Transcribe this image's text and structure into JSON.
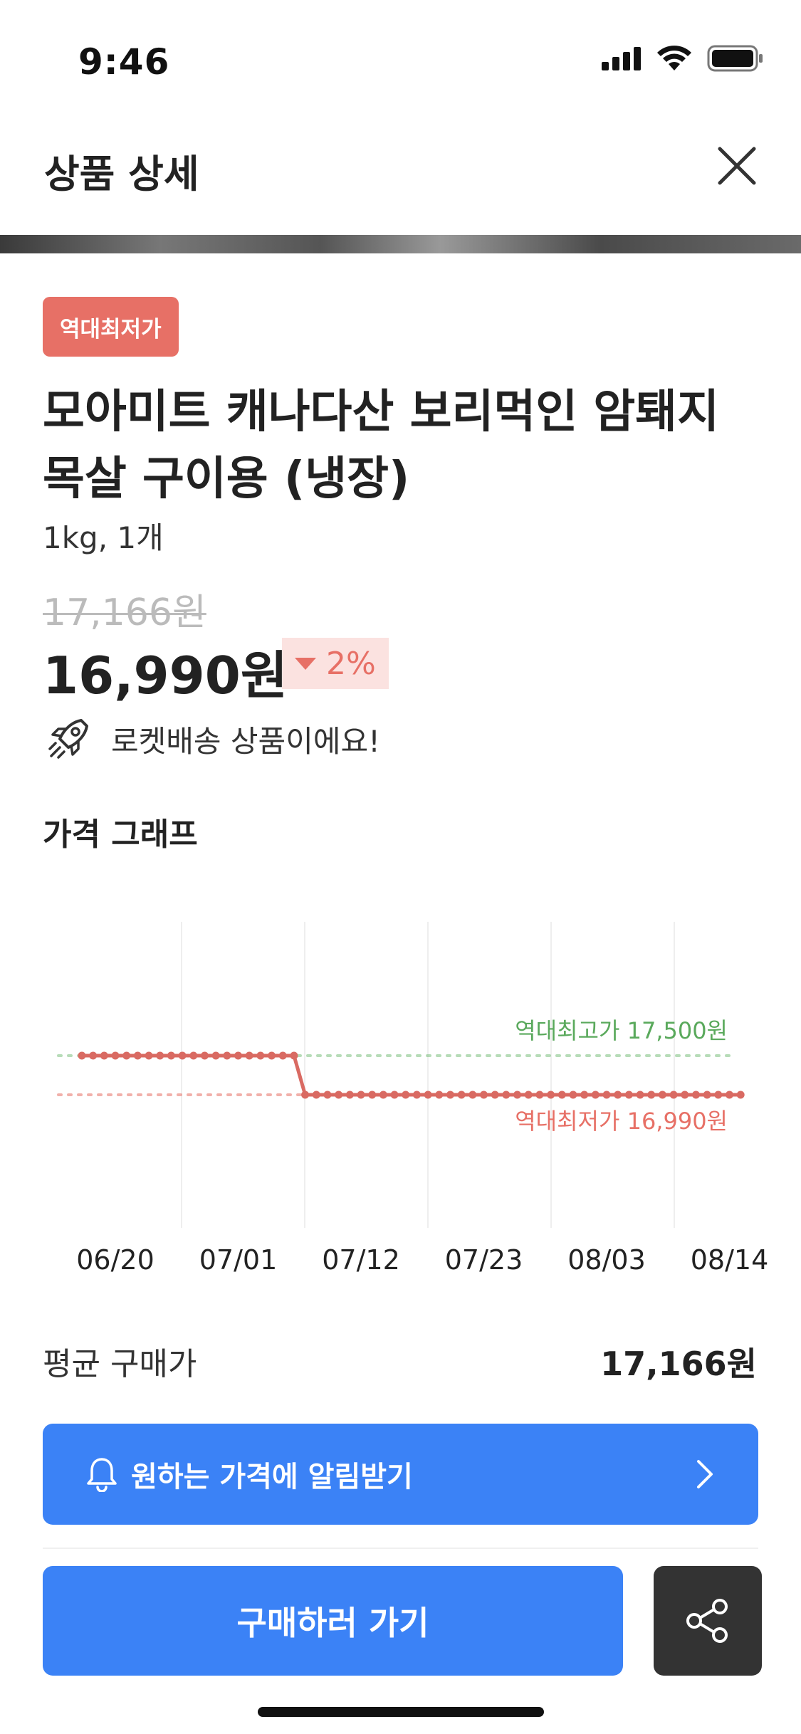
{
  "status_bar": {
    "time": "9:46",
    "icons": [
      "signal-icon",
      "wifi-icon",
      "battery-icon"
    ]
  },
  "header": {
    "title": "상품 상세",
    "close_icon": "close-icon"
  },
  "product": {
    "badge": "역대최저가",
    "title": "모아미트 캐나다산 보리먹인 암퇘지 목살 구이용 (냉장)",
    "option": "1kg, 1개",
    "original_price": "17,166원",
    "sale_price": "16,990원",
    "discount": "2%",
    "delivery_icon": "rocket-icon",
    "delivery_text": "로켓배송 상품이에요!"
  },
  "graph": {
    "title": "가격 그래프"
  },
  "chart_data": {
    "type": "line",
    "x_ticks": [
      "06/20",
      "07/01",
      "07/12",
      "07/23",
      "08/03",
      "08/14"
    ],
    "series": [
      {
        "points": [
          {
            "x": "06/17",
            "y": 17500
          },
          {
            "x": "07/06",
            "y": 17500
          },
          {
            "x": "07/07",
            "y": 16990
          },
          {
            "x": "08/15",
            "y": 16990
          }
        ],
        "color": "#d96a62"
      }
    ],
    "reference_lines": [
      {
        "label": "역대최고가 17,500원",
        "y": 17500,
        "color": "#7dc07f"
      },
      {
        "label": "역대최저가 16,990원",
        "y": 16990,
        "color": "#e77066"
      }
    ],
    "grid": "vertical"
  },
  "summary": {
    "avg_label": "평균 구매가",
    "avg_value": "17,166원"
  },
  "alert": {
    "label": "원하는 가격에 알림받기",
    "icon": "bell-icon",
    "chevron": "chevron-right-icon"
  },
  "actions": {
    "buy_label": "구매하러 가기",
    "share_icon": "share-icon"
  },
  "colors": {
    "accent": "#3b82f6",
    "badge": "#e77066",
    "high": "#5aa95c",
    "low": "#e77066"
  }
}
